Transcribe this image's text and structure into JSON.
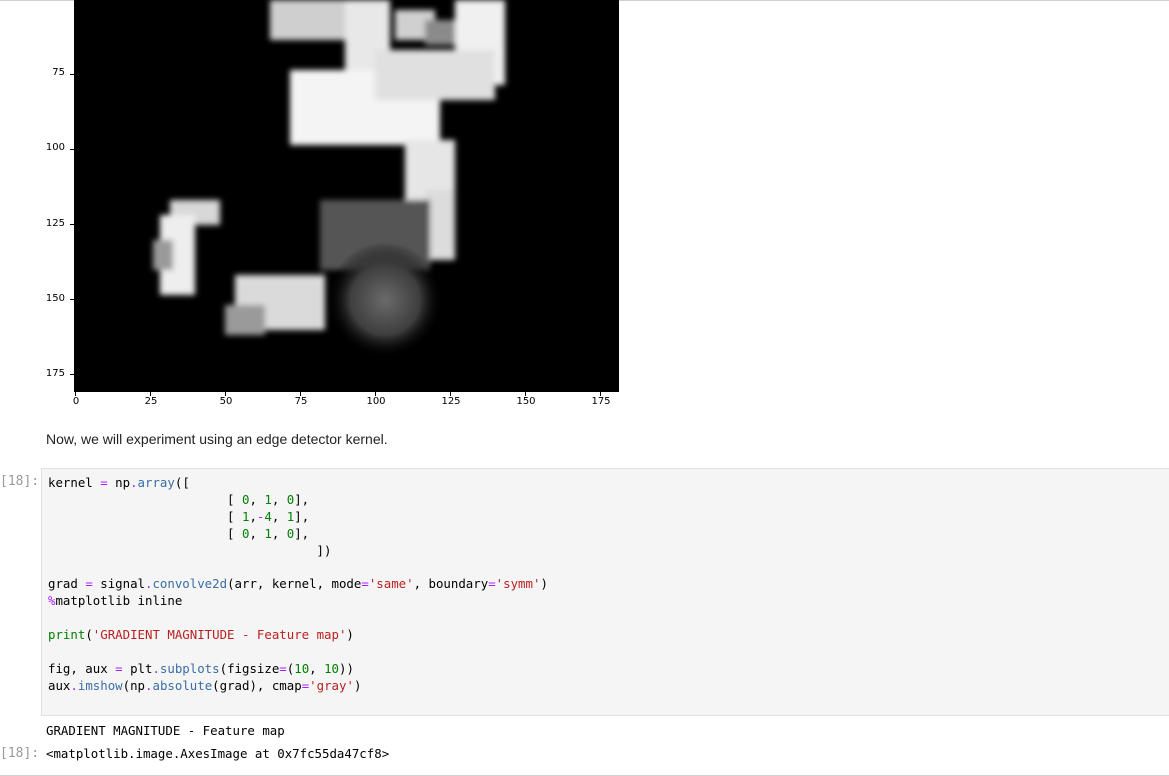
{
  "figure": {
    "y_ticks": [
      "75",
      "100",
      "125",
      "150",
      "175"
    ],
    "x_ticks": [
      "0",
      "25",
      "50",
      "75",
      "100",
      "125",
      "150",
      "175"
    ],
    "image_kind": "grayscale digit blur image"
  },
  "markdown": {
    "text": "Now, we will experiment using an edge detector kernel."
  },
  "cell": {
    "input_prompt": "[18]:",
    "output_prompt": "[18]:",
    "stdout": "GRADIENT MAGNITUDE - Feature map",
    "result": "<matplotlib.image.AxesImage at 0x7fc55da47cf8>"
  },
  "colors": {
    "code_bg": "#f5f5f5",
    "prompt": "#9a9a9a",
    "string": "#ba2121",
    "number": "#008000",
    "function": "#3a6ea5",
    "magic": "#aa22ff"
  }
}
